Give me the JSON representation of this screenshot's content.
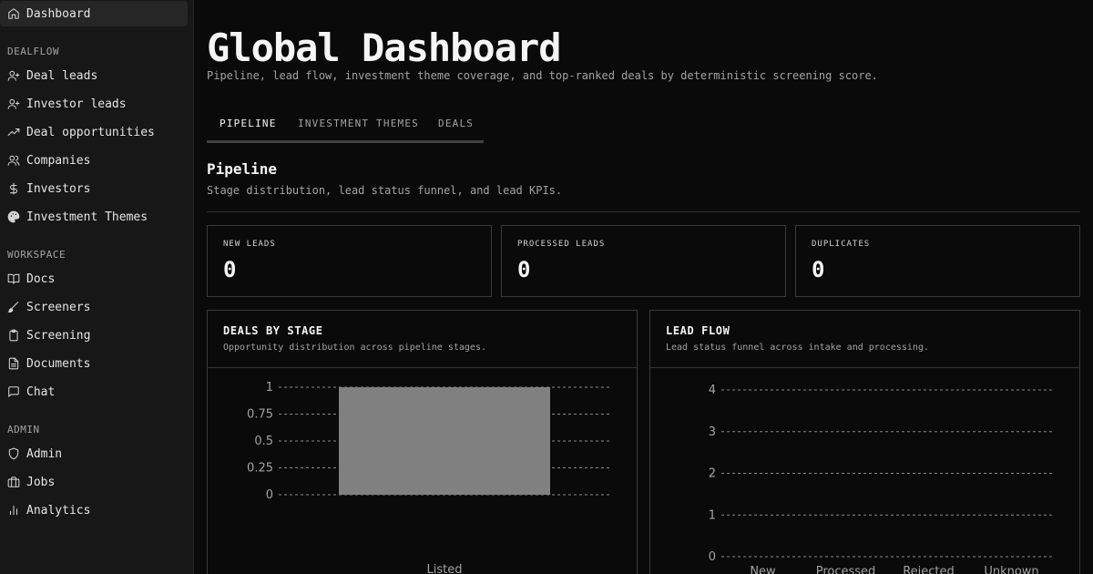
{
  "sidebar": {
    "top": {
      "label": "Dashboard",
      "icon": "home-icon"
    },
    "sections": [
      {
        "title": "DEALFLOW",
        "items": [
          {
            "label": "Deal leads",
            "icon": "user-plus-icon"
          },
          {
            "label": "Investor leads",
            "icon": "user-plus-icon"
          },
          {
            "label": "Deal opportunities",
            "icon": "trending-up-icon"
          },
          {
            "label": "Companies",
            "icon": "users-icon"
          },
          {
            "label": "Investors",
            "icon": "dollar-icon"
          },
          {
            "label": "Investment Themes",
            "icon": "palette-icon"
          }
        ]
      },
      {
        "title": "WORKSPACE",
        "items": [
          {
            "label": "Docs",
            "icon": "book-open-icon"
          },
          {
            "label": "Screeners",
            "icon": "brush-icon"
          },
          {
            "label": "Screening",
            "icon": "clipboard-icon"
          },
          {
            "label": "Documents",
            "icon": "file-text-icon"
          },
          {
            "label": "Chat",
            "icon": "message-square-icon"
          }
        ]
      },
      {
        "title": "ADMIN",
        "items": [
          {
            "label": "Admin",
            "icon": "shield-icon"
          },
          {
            "label": "Jobs",
            "icon": "briefcase-icon"
          },
          {
            "label": "Analytics",
            "icon": "bar-chart-icon"
          }
        ]
      }
    ]
  },
  "page": {
    "title": "Global Dashboard",
    "subtitle": "Pipeline, lead flow, investment theme coverage, and top-ranked deals by deterministic screening score."
  },
  "tabs": [
    {
      "label": "PIPELINE",
      "active": true
    },
    {
      "label": "INVESTMENT THEMES",
      "active": false
    },
    {
      "label": "DEALS",
      "active": false
    }
  ],
  "section": {
    "title": "Pipeline",
    "subtitle": "Stage distribution, lead status funnel, and lead KPIs."
  },
  "kpis": [
    {
      "label": "NEW LEADS",
      "value": "0"
    },
    {
      "label": "PROCESSED LEADS",
      "value": "0"
    },
    {
      "label": "DUPLICATES",
      "value": "0"
    }
  ],
  "panels": {
    "stage": {
      "title": "DEALS BY STAGE",
      "subtitle": "Opportunity distribution across pipeline stages."
    },
    "flow": {
      "title": "LEAD FLOW",
      "subtitle": "Lead status funnel across intake and processing."
    }
  },
  "chart_data": [
    {
      "type": "bar",
      "title": "DEALS BY STAGE",
      "categories": [
        "Listed"
      ],
      "values": [
        1
      ],
      "ylim": [
        0,
        1
      ],
      "yticks": [
        "0",
        "0.25",
        "0.5",
        "0.75",
        "1"
      ],
      "grid": true,
      "bar_color": "#808080"
    },
    {
      "type": "bar",
      "title": "LEAD FLOW",
      "categories": [
        "New",
        "Processed",
        "Rejected",
        "Unknown"
      ],
      "values": [
        0,
        0,
        0,
        0
      ],
      "ylim": [
        0,
        4
      ],
      "yticks": [
        "0",
        "1",
        "2",
        "3",
        "4"
      ],
      "grid": true,
      "bar_color": "#808080"
    }
  ]
}
